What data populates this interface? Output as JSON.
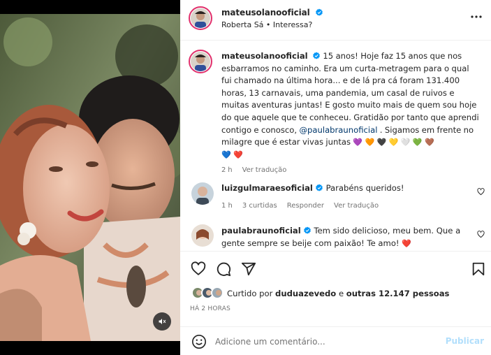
{
  "post": {
    "author": "mateusolanooficial",
    "subtitle": "Roberta Sá • Interessa?",
    "verified_icon": "verified-badge-icon",
    "more_icon": "more-options-icon"
  },
  "caption": {
    "username": "mateusolanooficial",
    "text_1": " 15 anos! Hoje faz 15 anos que nos esbarramos no caminho. Era um curta-metragem para o qual fui chamado na última hora... e de lá pra cá foram 131.400 horas, 13 carnavais, uma pandemia, um casal de ruivos e muitas aventuras juntas! E gosto muito mais de quem sou hoje do que aquele que te conheceu. Gratidão por tanto que aprendi contigo e conosco, ",
    "mention": "@paulabraunoficial",
    "text_2": " . Sigamos em frente no milagre que é estar vivas juntas ",
    "hearts": [
      "💜",
      "🧡",
      "🖤",
      "💛",
      "🤍",
      "💚",
      "🤎",
      "💙",
      "❤️"
    ],
    "time": "2 h",
    "translate": "Ver tradução"
  },
  "comments": [
    {
      "username": "luizgulmaraesoficial",
      "text": "Parabéns queridos!",
      "time": "1 h",
      "likes": "3 curtidas",
      "reply": "Responder",
      "translate": "Ver tradução"
    },
    {
      "username": "paulabraunoficial",
      "text": "Tem sido delicioso, meu bem. Que a gente sempre se beije com paixão! Te amo! ",
      "heart": "❤️"
    }
  ],
  "likes": {
    "prefix": "Curtido por ",
    "user": "duduazevedo",
    "middle": " e ",
    "others": "outras 12.147 pessoas"
  },
  "date": "HÁ 2 HORAS",
  "composer": {
    "placeholder": "Adicione um comentário...",
    "post_label": "Publicar"
  },
  "colors": {
    "text": "#262626",
    "muted": "#737373",
    "link": "#00376b",
    "verified": "#0095f6",
    "publish_disabled": "#b2dffc",
    "heart_red": "#ed4956"
  },
  "icons": [
    "like-icon",
    "comment-icon",
    "share-icon",
    "save-icon",
    "emoji-icon",
    "mute-icon"
  ]
}
